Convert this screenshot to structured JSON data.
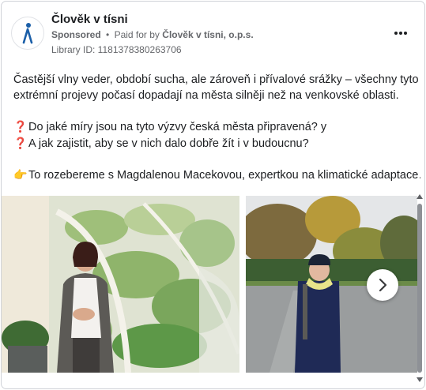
{
  "header": {
    "page_name": "Člověk v tísni",
    "sponsored_label": "Sponsored",
    "dot": "•",
    "paid_for_label": "Paid for by",
    "payer": "Člověk v tísni, o.p.s.",
    "library_id": "Library ID: 1181378380263706",
    "more_icon": "more-horizontal-icon"
  },
  "post": {
    "paragraph1": "Častější vlny veder, období sucha, ale zároveň i přívalové srážky – všechny tyto extrémní projevy počasí dopadají na města silněji než na venkovské oblasti.",
    "question1": "Do jaké míry jsou na tyto výzvy česká města připravená? y",
    "question2": "A jak zajistit, aby se v nich dalo dobře žít i v budoucnu?",
    "teaser": "To rozebereme s Magdalenou Macekovou, expertkou na klimatické adaptace…",
    "question_icon": "❓",
    "hand_icon": "👉"
  },
  "carousel": {
    "slides": [
      "woman-in-front-of-map-mural-photo",
      "woman-in-park-photo"
    ],
    "next_icon": "chevron-right-icon"
  },
  "colors": {
    "text": "#1c1e21",
    "secondary": "#65676b",
    "question": "#d9455f",
    "border": "#d0d3d8"
  }
}
